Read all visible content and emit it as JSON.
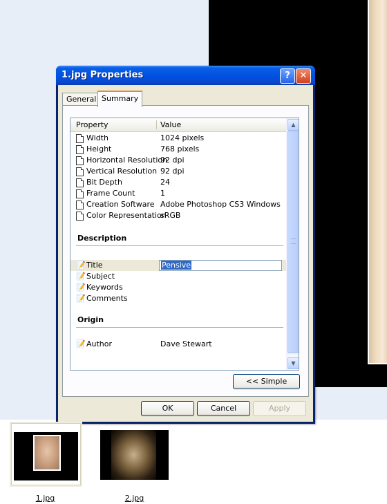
{
  "dialog": {
    "title": "1.jpg Properties",
    "help_glyph": "?",
    "close_glyph": "✕"
  },
  "tabs": [
    {
      "label": "General",
      "active": false
    },
    {
      "label": "Summary",
      "active": true
    }
  ],
  "list": {
    "columns": [
      "Property",
      "Value"
    ],
    "image_rows": [
      {
        "name": "Width",
        "value": "1024 pixels"
      },
      {
        "name": "Height",
        "value": "768 pixels"
      },
      {
        "name": "Horizontal Resolution",
        "value": "92 dpi"
      },
      {
        "name": "Vertical Resolution",
        "value": "92 dpi"
      },
      {
        "name": "Bit Depth",
        "value": "24"
      },
      {
        "name": "Frame Count",
        "value": "1"
      },
      {
        "name": "Creation Software",
        "value": "Adobe Photoshop CS3 Windows"
      },
      {
        "name": "Color Representation",
        "value": "sRGB"
      }
    ],
    "description_heading": "Description",
    "description_rows": [
      {
        "name": "Title",
        "value": "Pensive"
      },
      {
        "name": "Subject",
        "value": ""
      },
      {
        "name": "Keywords",
        "value": ""
      },
      {
        "name": "Comments",
        "value": ""
      }
    ],
    "origin_heading": "Origin",
    "origin_rows": [
      {
        "name": "Author",
        "value": "Dave Stewart"
      }
    ]
  },
  "buttons": {
    "simple": "<< Simple",
    "ok": "OK",
    "cancel": "Cancel",
    "apply": "Apply"
  },
  "thumbnails": [
    {
      "label": "1.jpg",
      "selected": true
    },
    {
      "label": "2.jpg",
      "selected": false
    }
  ],
  "colors": {
    "titlebar": "#0050e0",
    "dialog_face": "#ece9d8",
    "selection": "#316ac5",
    "tab_accent": "#e68b2c"
  }
}
